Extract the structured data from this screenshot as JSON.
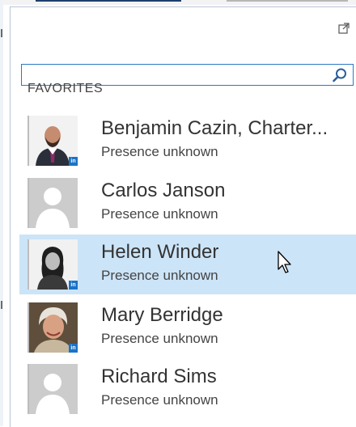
{
  "section": {
    "title": "FAVORITES"
  },
  "search": {
    "placeholder": "",
    "value": ""
  },
  "contacts": [
    {
      "name": "Benjamin Cazin, Charter...",
      "status": "Presence unknown",
      "photo": "man-with-beard-photo",
      "linkedin": true
    },
    {
      "name": "Carlos Janson",
      "status": "Presence unknown",
      "photo": "default-avatar",
      "linkedin": false
    },
    {
      "name": "Helen Winder",
      "status": "Presence unknown",
      "photo": "woman-photo",
      "linkedin": true,
      "selected": true
    },
    {
      "name": "Mary Berridge",
      "status": "Presence unknown",
      "photo": "woman-with-white-hair-photo",
      "linkedin": true
    },
    {
      "name": "Richard Sims",
      "status": "Presence unknown",
      "photo": "default-avatar",
      "linkedin": false
    }
  ],
  "badge_text": "in",
  "colors": {
    "accent": "#2b78c4",
    "selection": "#cce4f7",
    "linkedin": "#1a73c8"
  }
}
